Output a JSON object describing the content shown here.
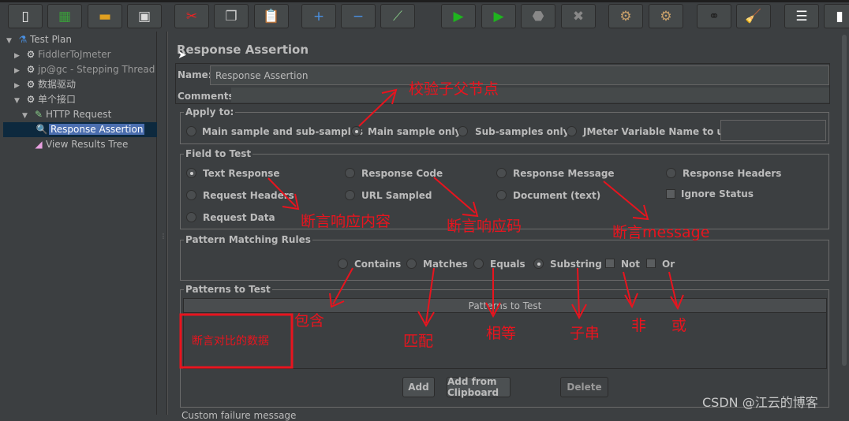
{
  "toolbar": {
    "buttons": [
      "new-icon",
      "templates-icon",
      "open-icon",
      "save-icon",
      "cut-icon",
      "copy-icon",
      "paste-icon",
      "expand-icon",
      "collapse-icon",
      "toggle-icon",
      "start-icon",
      "start-no-pause-icon",
      "stop-icon",
      "shutdown-icon",
      "clear-icon",
      "clear-all-icon",
      "search-icon",
      "reset-search-icon",
      "function-helper-icon"
    ]
  },
  "tree": {
    "items": [
      {
        "label": "Test Plan",
        "icon": "flask-icon",
        "expanded": true
      },
      {
        "label": "FiddlerToJmeter",
        "icon": "gear-icon",
        "expanded": false
      },
      {
        "label": "jp@gc - Stepping Thread G",
        "icon": "gear-icon",
        "expanded": false
      },
      {
        "label": "数据驱动",
        "icon": "gear-icon",
        "expanded": false
      },
      {
        "label": "单个接口",
        "icon": "gear-icon",
        "expanded": true
      },
      {
        "label": "HTTP Request",
        "icon": "pipette-icon",
        "expanded": true
      },
      {
        "label": "Response Assertion",
        "icon": "magnifier-icon",
        "selected": true
      },
      {
        "label": "View Results Tree",
        "icon": "chart-icon"
      }
    ]
  },
  "main": {
    "title": "Response Assertion",
    "name_label": "Name:",
    "name_value": "Response Assertion",
    "comments_label": "Comments:",
    "apply_to": {
      "legend": "Apply to:",
      "options": [
        "Main sample and sub-samples",
        "Main sample only",
        "Sub-samples only",
        "JMeter Variable Name to use"
      ],
      "selected": 1,
      "variable_value": ""
    },
    "field_to_test": {
      "legend": "Field to Test",
      "options": [
        "Text Response",
        "Response Code",
        "Response Message",
        "Response Headers",
        "Request Headers",
        "URL Sampled",
        "Document (text)",
        "Request Data"
      ],
      "selected": 0,
      "ignore_status_label": "Ignore Status",
      "ignore_status": false
    },
    "pattern_rules": {
      "legend": "Pattern Matching Rules",
      "options": [
        "Contains",
        "Matches",
        "Equals",
        "Substring"
      ],
      "selected": 3,
      "not_label": "Not",
      "or_label": "Or"
    },
    "patterns": {
      "legend": "Patterns to Test",
      "column": "Patterns to Test",
      "add": "Add",
      "add_clipboard": "Add from Clipboard",
      "delete": "Delete"
    },
    "custom_failure": "Custom failure message"
  },
  "annotations": {
    "parent": "校验子父节点",
    "text_response": "断言响应内容",
    "response_code": "断言响应码",
    "response_message": "断言message",
    "contains": "包含",
    "matches": "匹配",
    "equals": "相等",
    "substring": "子串",
    "not": "非",
    "or": "或",
    "data": "断言对比的数据",
    "color": "#e8141e"
  },
  "watermark": "CSDN @江云的博客"
}
